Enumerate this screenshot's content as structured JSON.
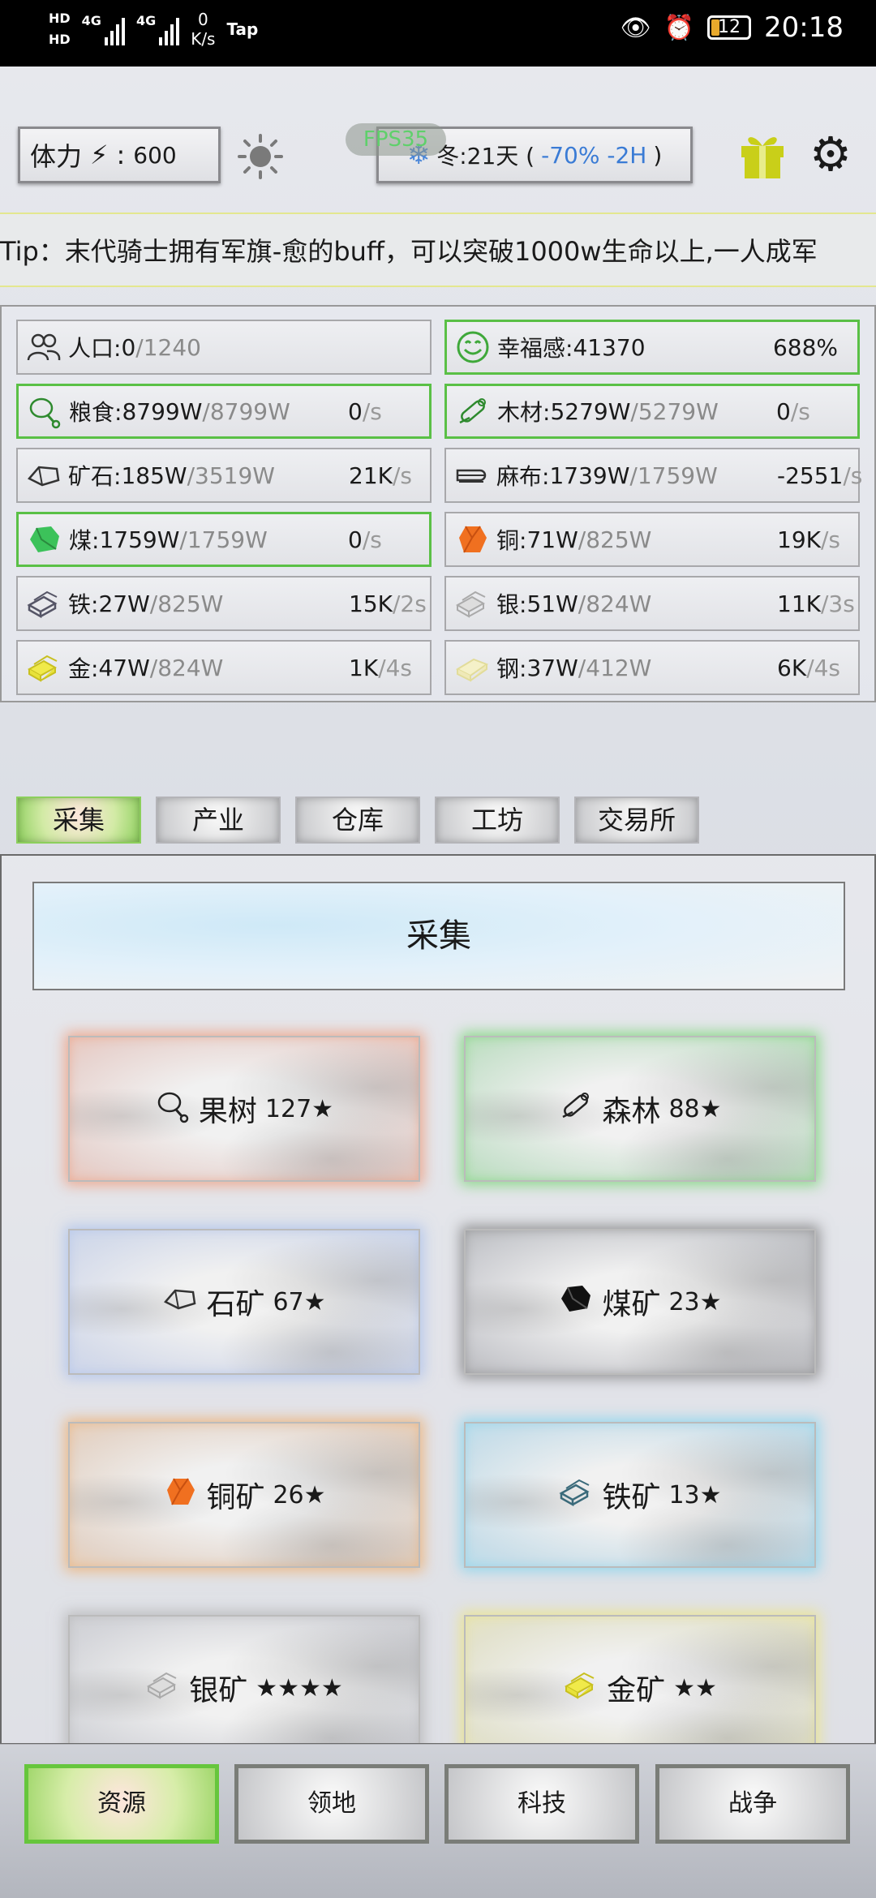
{
  "status_bar": {
    "hd1": "HD",
    "hd2": "HD",
    "sig1": "4G",
    "sig2": "4G",
    "net_speed": "0",
    "net_unit": "K/s",
    "app": "Tap",
    "battery": "12",
    "time": "20:18"
  },
  "header": {
    "stamina_label": "体力",
    "stamina_sep": ":",
    "stamina_value": "600",
    "fps": "FPS35",
    "season_label": "冬:21天 (",
    "season_mod": "-70% -2H",
    "season_close": ")"
  },
  "tip": "Tip：末代骑士拥有军旗-愈的buff，可以突破1000w生命以上,一人成军",
  "resources": [
    {
      "name": "人口:",
      "cur": "0",
      "max": "/1240",
      "rate": "",
      "unit": "",
      "icon": "people-icon",
      "highlight": false
    },
    {
      "name": "幸福感:",
      "cur": "41370",
      "max": "",
      "rate": "688%",
      "unit": "",
      "icon": "smile-icon",
      "highlight": true
    },
    {
      "name": "粮食:",
      "cur": "8799W",
      "max": "/8799W",
      "rate": "0",
      "unit": "/s",
      "icon": "meat-icon",
      "highlight": true
    },
    {
      "name": "木材:",
      "cur": "5279W",
      "max": "/5279W",
      "rate": "0",
      "unit": "/s",
      "icon": "wood-icon",
      "highlight": true
    },
    {
      "name": "矿石:",
      "cur": "185W",
      "max": "/3519W",
      "rate": "21K",
      "unit": "/s",
      "icon": "ore-icon",
      "highlight": false
    },
    {
      "name": "麻布:",
      "cur": "1739W",
      "max": "/1759W",
      "rate": "-2551",
      "unit": "/s",
      "icon": "cloth-icon",
      "highlight": false
    },
    {
      "name": "煤:",
      "cur": "1759W",
      "max": "/1759W",
      "rate": "0",
      "unit": "/s",
      "icon": "coal-icon",
      "highlight": true
    },
    {
      "name": "铜:",
      "cur": "71W",
      "max": "/825W",
      "rate": "19K",
      "unit": "/s",
      "icon": "copper-icon",
      "highlight": false
    },
    {
      "name": "铁:",
      "cur": "27W",
      "max": "/825W",
      "rate": "15K",
      "unit": "/2s",
      "icon": "iron-icon",
      "highlight": false
    },
    {
      "name": "银:",
      "cur": "51W",
      "max": "/824W",
      "rate": "11K",
      "unit": "/3s",
      "icon": "silver-icon",
      "highlight": false
    },
    {
      "name": "金:",
      "cur": "47W",
      "max": "/824W",
      "rate": "1K",
      "unit": "/4s",
      "icon": "gold-icon",
      "highlight": false
    },
    {
      "name": "钢:",
      "cur": "37W",
      "max": "/412W",
      "rate": "6K",
      "unit": "/4s",
      "icon": "steel-icon",
      "highlight": false
    }
  ],
  "tabs": [
    "采集",
    "产业",
    "仓库",
    "工坊",
    "交易所"
  ],
  "content_title": "采集",
  "cards": [
    {
      "label": "果树",
      "stars": "127★",
      "icon": "meat-icon",
      "glow": "#f28a62"
    },
    {
      "label": "森林",
      "stars": "88★",
      "icon": "wood-icon",
      "glow": "#5ed05a"
    },
    {
      "label": "石矿",
      "stars": "67★",
      "icon": "ore-icon",
      "glow": "#9fb8ec"
    },
    {
      "label": "煤矿",
      "stars": "23★",
      "icon": "coal-icon",
      "glow": "#6b6b6b"
    },
    {
      "label": "铜矿",
      "stars": "26★",
      "icon": "copper-icon",
      "glow": "#f0a356"
    },
    {
      "label": "铁矿",
      "stars": "13★",
      "icon": "iron-icon",
      "glow": "#6ed0ee"
    },
    {
      "label": "银矿",
      "stars": "★★★★",
      "icon": "silver-icon",
      "glow": "#aaaaaa"
    },
    {
      "label": "金矿",
      "stars": "★★",
      "icon": "gold-icon",
      "glow": "#eee66a"
    }
  ],
  "bottom_nav": [
    "资源",
    "领地",
    "科技",
    "战争"
  ],
  "colors": {
    "accent_green": "#5ac046",
    "blue_text": "#3a7bd5",
    "gift_yellow": "#c9cf19",
    "copper": "#f07020",
    "coal": "#3cc25a",
    "gold": "#e8e23a"
  }
}
